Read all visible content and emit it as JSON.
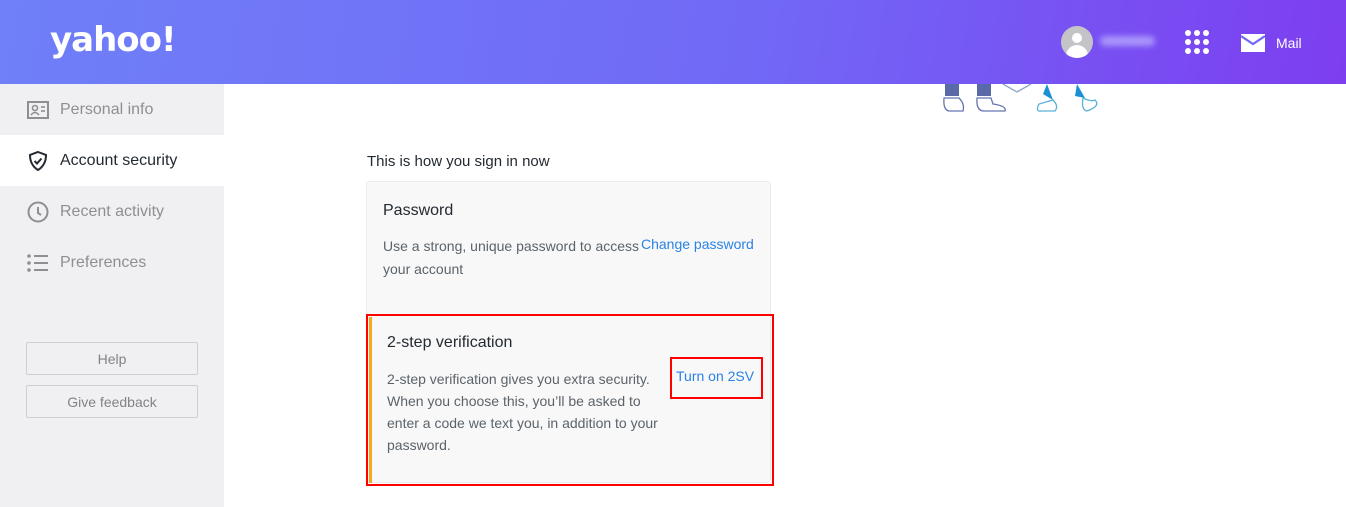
{
  "header": {
    "logo": "yahoo!",
    "mail_label": "Mail",
    "icons": {
      "avatar": "user-avatar-icon",
      "apps": "apps-grid-icon",
      "mail": "mail-envelope-icon"
    }
  },
  "sidebar": {
    "items": [
      {
        "label": "Personal info",
        "icon": "id-card-icon",
        "active": false
      },
      {
        "label": "Account security",
        "icon": "shield-check-icon",
        "active": true
      },
      {
        "label": "Recent activity",
        "icon": "clock-icon",
        "active": false
      },
      {
        "label": "Preferences",
        "icon": "list-icon",
        "active": false
      }
    ],
    "help_label": "Help",
    "feedback_label": "Give feedback"
  },
  "main": {
    "section_title": "This is how you sign in now",
    "password": {
      "title": "Password",
      "description": "Use a strong, unique password to access your account",
      "action": "Change password"
    },
    "two_step": {
      "title": "2-step verification",
      "description": "2-step verification gives you extra security. When you choose this, you’ll be asked to enter a code we text you, in addition to your password.",
      "action": "Turn on 2SV"
    }
  },
  "colors": {
    "link": "#2a82e6",
    "highlight": "#ff0000",
    "accent": "#f5a623",
    "header_start": "#6f80f8",
    "header_end": "#7d3ef0"
  }
}
